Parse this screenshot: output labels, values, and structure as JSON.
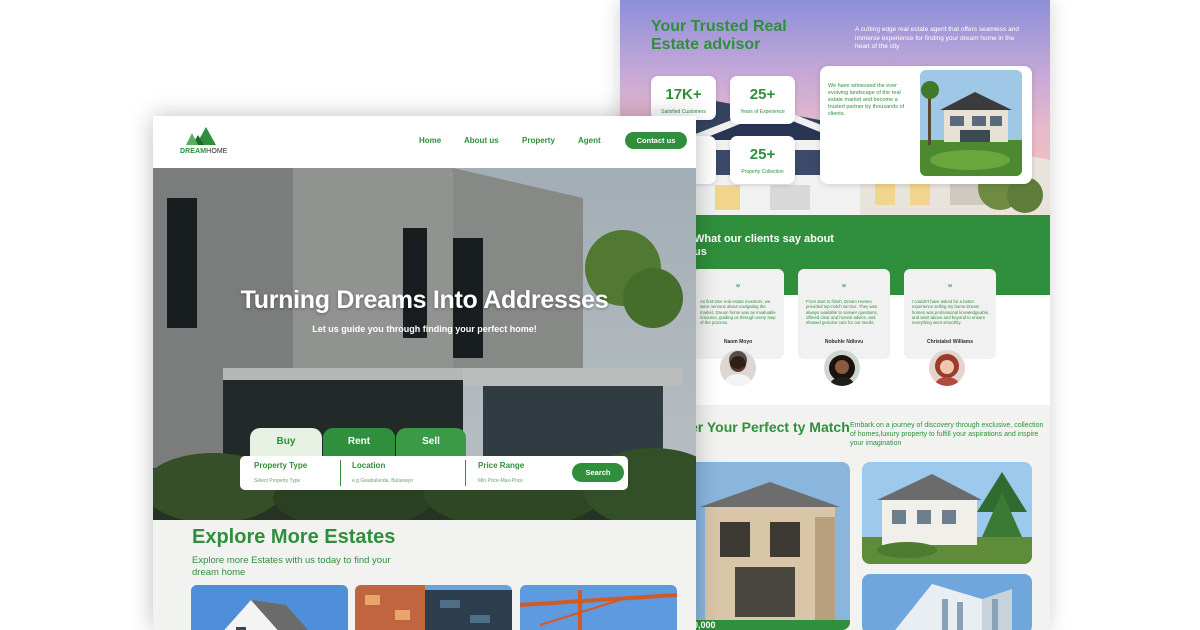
{
  "back": {
    "title": "Your Trusted Real Estate advisor",
    "description": "A cutting edge real estate agent that offers seamless and  immerse experience for finding your dream home in the heart of the city",
    "stats": [
      {
        "num": "17K+",
        "label": "Satisfied Customers"
      },
      {
        "num": "25+",
        "label": "Years of Experience"
      },
      {
        "num": "25+",
        "label": "Property Collection"
      }
    ],
    "card_text": "We have witnessed the ever evolving landscape of the real estate market and become a trusted partner by thousands of clients.",
    "clients_title": "What our clients say about us",
    "testimonials": [
      {
        "quote": "”",
        "text": "As first-time real estate investors, we were nervous about navigating the market. Dream home was an invaluable resource, guiding us through every step of the process.",
        "name": "Naom Moyo"
      },
      {
        "quote": "”",
        "text": "From start to finish, Dream Homes provided top-notch service. They was always available to answer questions, offered clear and honest advice, and showed genuine care for our needs.",
        "name": "Nobuhle Ndlovu"
      },
      {
        "quote": "”",
        "text": "I couldn't have asked for a better experience selling my home.Dream homes was professional knowledgeable, and went above and beyond to ensure everything went smoothly.",
        "name": "Christabel Williams"
      }
    ],
    "discover_title": "er Your Perfect ty Match",
    "discover_desc": "Embark on a journey of discovery through exclusive, collection of homes,luxury property to fulfill your aspirations and inspire your imagination",
    "price_fragment": "00,000"
  },
  "front": {
    "logo_text_strong": "DREAM",
    "logo_text_rest": "HOME",
    "nav": [
      "Home",
      "About us",
      "Property",
      "Agent"
    ],
    "contact_label": "Contact us",
    "hero_title": "Turning Dreams Into Addresses",
    "hero_sub": "Let us guide you through finding your perfect  home!",
    "tabs": [
      "Buy",
      "Rent",
      "Sell"
    ],
    "search": {
      "fields": [
        {
          "label": "Property Type",
          "placeholder": "Select Property Type"
        },
        {
          "label": "Location",
          "placeholder": "e.g Gwabalanda, Bulawayo"
        },
        {
          "label": "Price Range",
          "placeholder": "Min Price-Max-Price"
        }
      ],
      "button": "Search"
    },
    "explore_title": "Explore More  Estates",
    "explore_sub": "Explore more Estates with us today to find your dream home"
  },
  "colors": {
    "brand": "#2f8f3c",
    "background": "#f2f3f1"
  }
}
